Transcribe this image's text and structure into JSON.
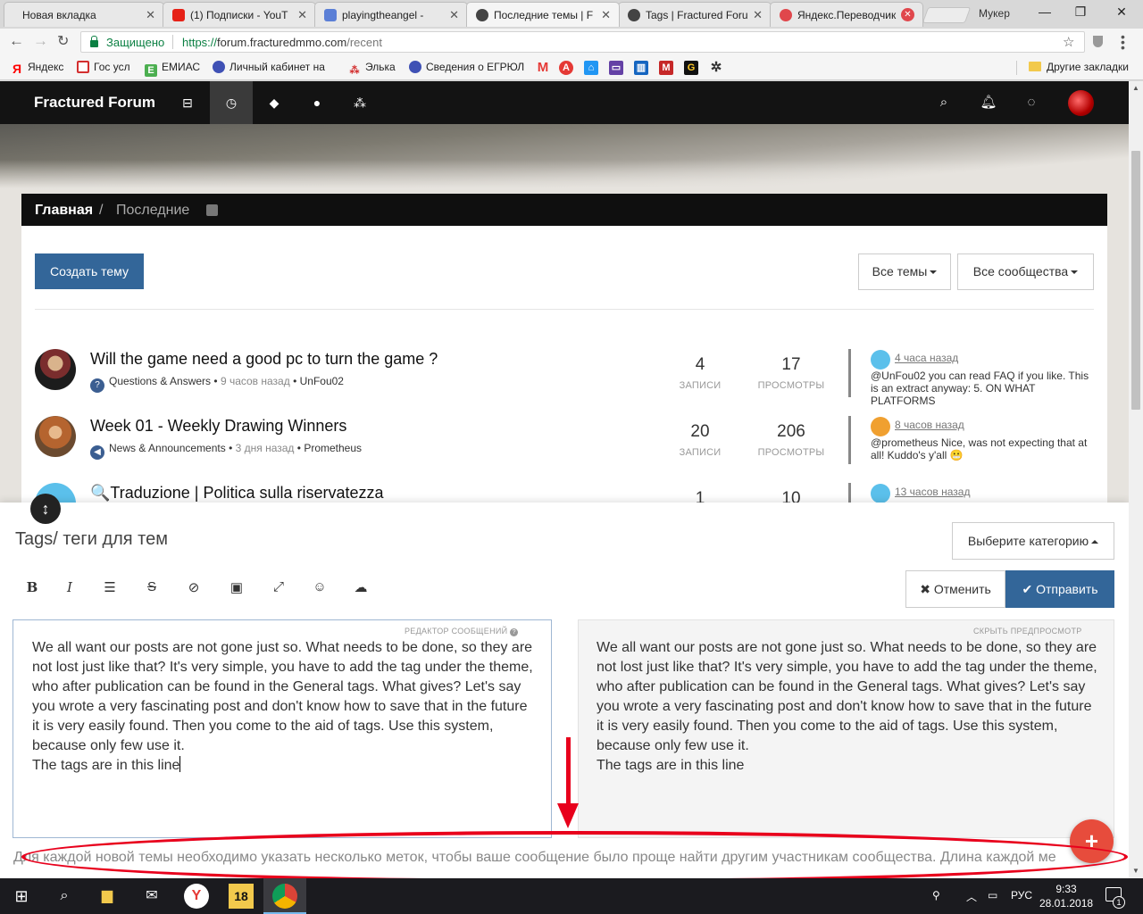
{
  "browser": {
    "tabs": [
      {
        "label": "Новая вкладка",
        "favicon_color": "#e8e8e8"
      },
      {
        "label": "(1) Подписки - YouT",
        "favicon_color": "#e62117"
      },
      {
        "label": "playingtheangel -",
        "favicon_color": "#5b7fd6"
      },
      {
        "label": "Последние темы | F",
        "favicon_color": "#444444"
      },
      {
        "label": "Tags | Fractured Foru",
        "favicon_color": "#444444"
      },
      {
        "label": "Яндекс.Переводчик",
        "favicon_color": "#e0474c"
      }
    ],
    "profile_name": "Мукер",
    "address": {
      "secure_label": "Защищено",
      "scheme": "https://",
      "host": "forum.fracturedmmo.com",
      "path": "/recent"
    },
    "bookmarks": [
      {
        "label": "Яндекс",
        "icon": "yandex-icon",
        "color": "#ff0000"
      },
      {
        "label": "Гос усл",
        "icon": "gosuslugi-icon",
        "color": "#d32f2f"
      },
      {
        "label": "ЕМИАС",
        "icon": "emias-icon",
        "color": "#4caf50"
      },
      {
        "label": "Личный кабинет на",
        "icon": "tax-icon",
        "color": "#3f51b5"
      },
      {
        "label": "Элька",
        "icon": "elka-icon",
        "color": "#d32f2f"
      },
      {
        "label": "Сведения о ЕГРЮЛ",
        "icon": "egrul-icon",
        "color": "#3f51b5"
      }
    ],
    "other_bookmarks": "Другие закладки"
  },
  "site": {
    "brand": "Fractured Forum",
    "breadcrumb": {
      "home": "Главная",
      "separator": "/",
      "current": "Последние"
    },
    "create_topic": "Создать тему",
    "filter_topics": "Все темы",
    "filter_categories": "Все сообщества"
  },
  "topics": [
    {
      "title": "Will the game need a good pc to turn the game ?",
      "category": "Questions & Answers",
      "time": "9 часов назад",
      "author": "UnFou02",
      "posts": "4",
      "posts_label": "ЗАПИСИ",
      "views": "17",
      "views_label": "ПРОСМОТРЫ",
      "teaser_when": "4 часа назад",
      "teaser_text": "@UnFou02 you can read FAQ if you like. This is an extract anyway: 5. ON WHAT PLATFORMS"
    },
    {
      "title": "Week 01 - Weekly Drawing Winners",
      "category": "News & Announcements",
      "time": "3 дня назад",
      "author": "Prometheus",
      "posts": "20",
      "posts_label": "ЗАПИСИ",
      "views": "206",
      "views_label": "ПРОСМОТРЫ",
      "teaser_when": "8 часов назад",
      "teaser_text": "@prometheus Nice, was not expecting that at all! Kuddo's y'all 😬"
    },
    {
      "title": "🔍Traduzione | Politica sulla riservatezza",
      "posts": "1",
      "views": "10",
      "teaser_when": "13 часов назад"
    }
  ],
  "composer": {
    "title": "Tags/ теги для тем",
    "category_select": "Выберите категорию",
    "cancel": "✖ Отменить",
    "submit": "✔ Отправить",
    "editor_hint": "РЕДАКТОР СООБЩЕНИЙ",
    "preview_hint": "СКРЫТЬ ПРЕДПРОСМОТР",
    "body": "We all want our posts are not gone just so. What needs to be done, so they are\nnot lost just like that? It's very simple, you have to add the tag under the theme,\nwho after publication can be found in the General tags. What gives? Let's say\nyou wrote a very fascinating post and don't know how to save that in the future\nit is very easily found. Then you come to the aid of tags. Use this system,\nbecause only few use it.\nThe tags are in this line",
    "tags_placeholder": "Для каждой новой темы необходимо указать несколько меток, чтобы ваше сообщение было проще найти другим участникам сообщества. Длина каждой ме"
  },
  "taskbar": {
    "time": "9:33",
    "date": "28.01.2018",
    "lang": "РУС",
    "notifications": "1",
    "app_badge": "18"
  },
  "colors": {
    "accent": "#336699",
    "annotation": "#e8001c",
    "fab": "#e74c3c"
  }
}
